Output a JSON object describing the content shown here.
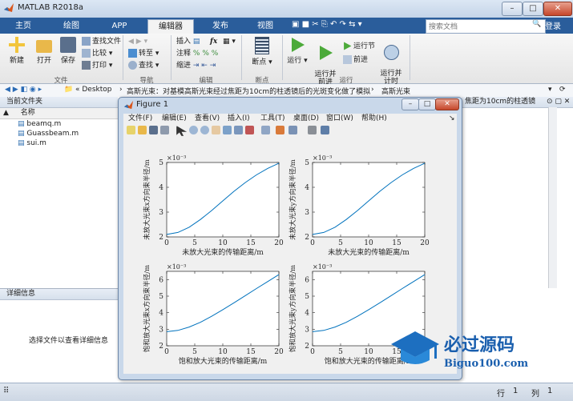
{
  "window": {
    "title": "MATLAB R2018a",
    "min": "–",
    "max": "□",
    "close": "✕"
  },
  "tabs": [
    {
      "label": "主页",
      "active": false
    },
    {
      "label": "绘图",
      "active": false
    },
    {
      "label": "APP",
      "active": false
    },
    {
      "label": "编辑器",
      "active": true
    },
    {
      "label": "发布",
      "active": false
    },
    {
      "label": "视图",
      "active": false
    }
  ],
  "search": {
    "placeholder": "搜索文档"
  },
  "login": "登录",
  "ribbon": {
    "file": {
      "new": "新建",
      "open": "打开",
      "save": "保存",
      "find_files": "查找文件",
      "compare": "比较",
      "print": "打印",
      "group": "文件"
    },
    "nav": {
      "goto": "转至",
      "find": "查找",
      "group": "导航"
    },
    "edit": {
      "insert": "插入",
      "fx": "fx",
      "comment": "注释",
      "indent": "缩进",
      "group": "编辑"
    },
    "breakpoints": {
      "label": "断点",
      "group": "断点"
    },
    "run": {
      "run": "运行",
      "run_advance": "运行并\n前进",
      "run_section": "运行节",
      "advance": "前进",
      "run_time": "运行并\n计时",
      "group": "运行"
    }
  },
  "address": {
    "prefix": "« Desktop",
    "sep": "›",
    "folder": "高斯光束：对基模高斯光束经过焦距为10cm的柱透镜后的光斑变化做了模拟",
    "sub": "高斯光束"
  },
  "left": {
    "header": "当前文件夹",
    "col": "名称",
    "sort": "▲",
    "files": [
      "beamq.m",
      "Guassbeam.m",
      "sui.m"
    ],
    "detail_header": "详细信息",
    "detail_text": "选择文件以查看详细信息"
  },
  "right_strip": "焦距为10cm的柱透镜",
  "figure": {
    "title": "Figure 1",
    "menu": [
      "文件(F)",
      "编辑(E)",
      "查看(V)",
      "插入(I)",
      "工具(T)",
      "桌面(D)",
      "窗口(W)",
      "帮助(H)"
    ],
    "menu_arrow": "↘"
  },
  "status": {
    "row_label": "行",
    "row": "1",
    "col_label": "列",
    "col": "1"
  },
  "watermark": {
    "cn": "必过源码",
    "url": "Biguo100.com"
  },
  "chart_data": [
    {
      "type": "line",
      "title": "",
      "xlabel": "未放大光束的传输距离/m",
      "ylabel": "未放大光束x方向束半径/m",
      "exponent": "×10⁻³",
      "xlim": [
        0,
        20
      ],
      "ylim": [
        2,
        5
      ],
      "xticks": [
        "0",
        "5",
        "10",
        "15",
        "20"
      ],
      "yticks": [
        "2",
        "3",
        "4",
        "5"
      ],
      "x": [
        0,
        2,
        4,
        6,
        8,
        10,
        12,
        14,
        16,
        18,
        20
      ],
      "y": [
        2.1,
        2.18,
        2.39,
        2.7,
        3.06,
        3.45,
        3.84,
        4.19,
        4.5,
        4.76,
        4.97
      ]
    },
    {
      "type": "line",
      "title": "",
      "xlabel": "未放大光束的传输距离/m",
      "ylabel": "未放大光束y方向束半径/m",
      "exponent": "×10⁻³",
      "xlim": [
        0,
        20
      ],
      "ylim": [
        2,
        5
      ],
      "xticks": [
        "0",
        "5",
        "10",
        "15",
        "20"
      ],
      "yticks": [
        "2",
        "3",
        "4",
        "5"
      ],
      "x": [
        0,
        2,
        4,
        6,
        8,
        10,
        12,
        14,
        16,
        18,
        20
      ],
      "y": [
        2.1,
        2.18,
        2.39,
        2.7,
        3.06,
        3.45,
        3.84,
        4.19,
        4.5,
        4.76,
        4.97
      ]
    },
    {
      "type": "line",
      "title": "",
      "xlabel": "饱和放大光束的传输距离/m",
      "ylabel": "饱和放大光束x方向束半径/m",
      "exponent": "×10⁻³",
      "xlim": [
        0,
        20
      ],
      "ylim": [
        2,
        6.5
      ],
      "xticks": [
        "0",
        "5",
        "10",
        "15",
        "20"
      ],
      "yticks": [
        "2",
        "3",
        "4",
        "5",
        "6"
      ],
      "x": [
        0,
        2,
        4,
        6,
        8,
        10,
        12,
        14,
        16,
        18,
        20
      ],
      "y": [
        2.85,
        2.93,
        3.13,
        3.42,
        3.78,
        4.18,
        4.6,
        5.03,
        5.46,
        5.88,
        6.3
      ]
    },
    {
      "type": "line",
      "title": "",
      "xlabel": "饱和放大光束的传输距离/m",
      "ylabel": "饱和放大光束y方向束半径/m",
      "exponent": "×10⁻³",
      "xlim": [
        0,
        20
      ],
      "ylim": [
        2,
        6.5
      ],
      "xticks": [
        "0",
        "5",
        "10",
        "15",
        "20"
      ],
      "yticks": [
        "2",
        "3",
        "4",
        "5",
        "6"
      ],
      "x": [
        0,
        2,
        4,
        6,
        8,
        10,
        12,
        14,
        16,
        18,
        20
      ],
      "y": [
        2.85,
        2.93,
        3.13,
        3.42,
        3.78,
        4.18,
        4.6,
        5.03,
        5.46,
        5.88,
        6.3
      ]
    }
  ]
}
